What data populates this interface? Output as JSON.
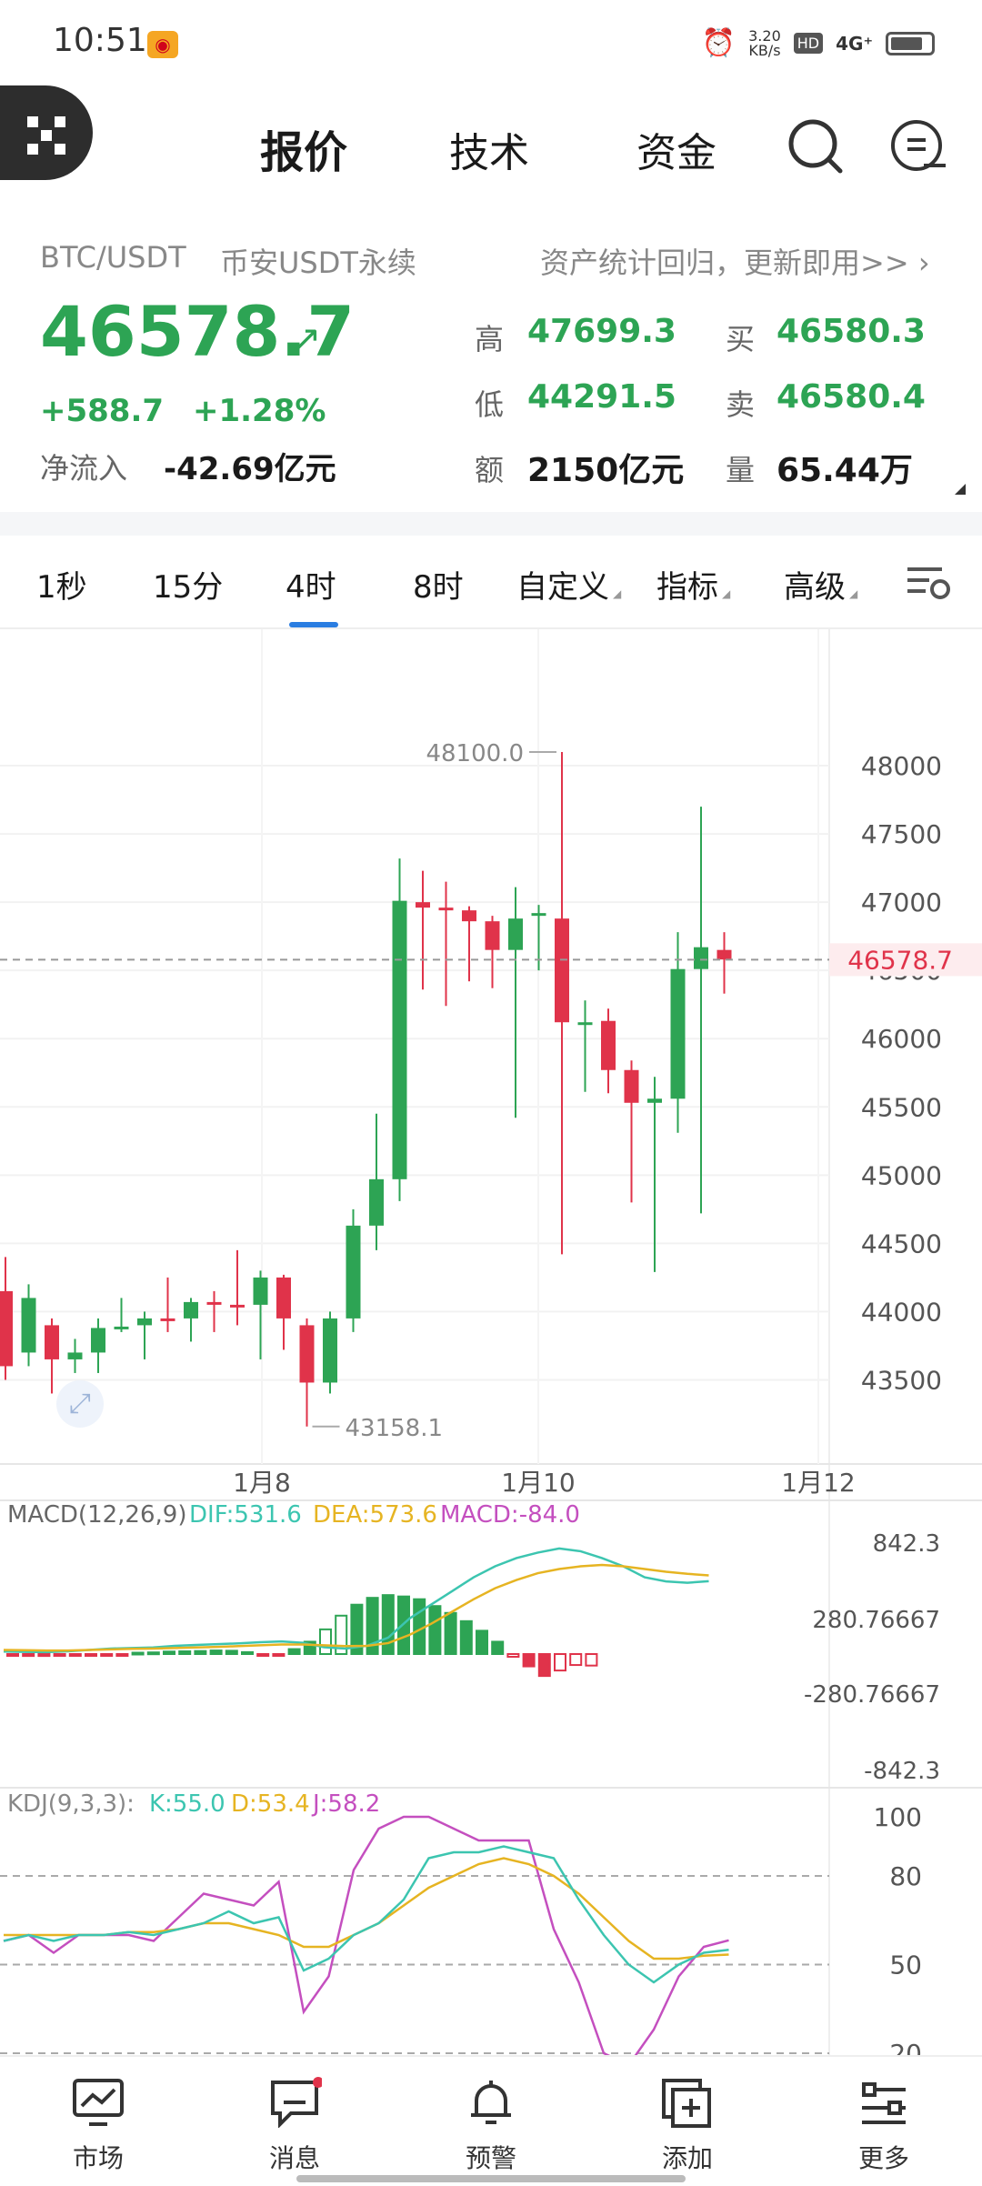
{
  "status_bar": {
    "time": "10:51",
    "net_speed": "3.20\nKB/s",
    "hd": "HD",
    "signal": "4G⁺"
  },
  "header": {
    "tabs": [
      {
        "label": "报价"
      },
      {
        "label": "技术"
      },
      {
        "label": "资金"
      }
    ],
    "active_tab": "报价"
  },
  "ticker": {
    "pair": "BTC/USDT",
    "market": "币安USDT永续",
    "promo": "资产统计回归，更新即用>>",
    "price": "46578.7",
    "change_abs": "+588.7",
    "change_pct": "+1.28%",
    "net_inflow_label": "净流入",
    "net_inflow_value": "-42.69亿元",
    "stats": {
      "high_label": "高",
      "high_value": "47699.3",
      "low_label": "低",
      "low_value": "44291.5",
      "amount_label": "额",
      "amount_value": "2150亿元",
      "buy_label": "买",
      "buy_value": "46580.3",
      "sell_label": "卖",
      "sell_value": "46580.4",
      "volume_label": "量",
      "volume_value": "65.44万"
    },
    "colors": {
      "up": "#2da454",
      "down": "#e0334a"
    }
  },
  "intervals": {
    "items": [
      {
        "label": "1秒"
      },
      {
        "label": "15分"
      },
      {
        "label": "4时"
      },
      {
        "label": "8时"
      },
      {
        "label": "自定义"
      },
      {
        "label": "指标"
      },
      {
        "label": "高级"
      }
    ],
    "active": "4时"
  },
  "chart_data": {
    "type": "candlestick",
    "x_ticks": [
      "1月8",
      "1月10",
      "1月12"
    ],
    "y_ticks": [
      48000,
      47500,
      47000,
      46500,
      46000,
      45500,
      45000,
      44500,
      44000,
      43500
    ],
    "ylim": [
      42950,
      48600
    ],
    "current_price_label": "46578.7",
    "high_marker": "48100.0",
    "low_marker": "43158.1",
    "candles": [
      {
        "o": 44150,
        "c": 43600,
        "h": 44400,
        "l": 43500
      },
      {
        "o": 43700,
        "c": 44100,
        "h": 44200,
        "l": 43600
      },
      {
        "o": 43900,
        "c": 43650,
        "h": 43950,
        "l": 43400
      },
      {
        "o": 43650,
        "c": 43700,
        "h": 43800,
        "l": 43550
      },
      {
        "o": 43700,
        "c": 43880,
        "h": 43950,
        "l": 43550
      },
      {
        "o": 43880,
        "c": 43890,
        "h": 44100,
        "l": 43850
      },
      {
        "o": 43900,
        "c": 43950,
        "h": 44000,
        "l": 43650
      },
      {
        "o": 43950,
        "c": 43940,
        "h": 44250,
        "l": 43850
      },
      {
        "o": 43950,
        "c": 44070,
        "h": 44100,
        "l": 43780
      },
      {
        "o": 44070,
        "c": 44050,
        "h": 44150,
        "l": 43850
      },
      {
        "o": 44050,
        "c": 44040,
        "h": 44450,
        "l": 43900
      },
      {
        "o": 44050,
        "c": 44250,
        "h": 44300,
        "l": 43650
      },
      {
        "o": 44250,
        "c": 43950,
        "h": 44270,
        "l": 43720
      },
      {
        "o": 43900,
        "c": 43480,
        "h": 43950,
        "l": 43158.1
      },
      {
        "o": 43480,
        "c": 43950,
        "h": 44000,
        "l": 43400
      },
      {
        "o": 43950,
        "c": 44630,
        "h": 44750,
        "l": 43850
      },
      {
        "o": 44630,
        "c": 44970,
        "h": 45450,
        "l": 44450
      },
      {
        "o": 44970,
        "c": 47010,
        "h": 47320,
        "l": 44810
      },
      {
        "o": 47000,
        "c": 46960,
        "h": 47230,
        "l": 46360
      },
      {
        "o": 46960,
        "c": 46940,
        "h": 47150,
        "l": 46240
      },
      {
        "o": 46940,
        "c": 46860,
        "h": 46970,
        "l": 46420
      },
      {
        "o": 46860,
        "c": 46650,
        "h": 46900,
        "l": 46370
      },
      {
        "o": 46650,
        "c": 46880,
        "h": 47110,
        "l": 45420
      },
      {
        "o": 46900,
        "c": 46920,
        "h": 46980,
        "l": 46500
      },
      {
        "o": 46880,
        "c": 46120,
        "h": 48100,
        "l": 44420
      },
      {
        "o": 46120,
        "c": 46120,
        "h": 46280,
        "l": 45610
      },
      {
        "o": 46130,
        "c": 45770,
        "h": 46220,
        "l": 45600
      },
      {
        "o": 45770,
        "c": 45530,
        "h": 45840,
        "l": 44800
      },
      {
        "o": 45530,
        "c": 45560,
        "h": 45720,
        "l": 44290
      },
      {
        "o": 45560,
        "c": 46510,
        "h": 46780,
        "l": 45310
      },
      {
        "o": 46510,
        "c": 46670,
        "h": 47700,
        "l": 44720
      },
      {
        "o": 46650,
        "c": 46580,
        "h": 46780,
        "l": 46330
      }
    ],
    "macd": {
      "label": "MACD(12,26,9)",
      "dif_text": "DIF:531.6",
      "dea_text": "DEA:573.6",
      "macd_text": "MACD:-84.0",
      "y_ticks": [
        "842.3",
        "280.76667",
        "-280.76667",
        "-842.3"
      ],
      "ylim": [
        -842.3,
        842.3
      ],
      "histogram": [
        -12,
        -14,
        -14,
        -12,
        -9,
        -6,
        -4,
        -3,
        10,
        12,
        18,
        20,
        22,
        26,
        24,
        14,
        -8,
        -4,
        36,
        90,
        180,
        280,
        360,
        410,
        430,
        420,
        400,
        350,
        300,
        240,
        170,
        90,
        -20,
        -90,
        -160,
        -120,
        -80,
        -84
      ],
      "dif": [
        18,
        16,
        14,
        20,
        30,
        40,
        44,
        48,
        60,
        66,
        72,
        78,
        86,
        92,
        82,
        50,
        40,
        60,
        120,
        260,
        360,
        460,
        560,
        640,
        700,
        740,
        770,
        750,
        700,
        640,
        560,
        530,
        520,
        531.6
      ],
      "dea": [
        30,
        28,
        26,
        26,
        30,
        34,
        38,
        40,
        44,
        48,
        52,
        58,
        64,
        70,
        70,
        64,
        58,
        60,
        80,
        140,
        220,
        310,
        400,
        480,
        540,
        590,
        620,
        640,
        650,
        640,
        620,
        600,
        585,
        573.6
      ]
    },
    "kdj": {
      "label": "KDJ(9,3,3):",
      "k_text": "K:55.0",
      "d_text": "D:53.4",
      "j_text": "J:58.2",
      "y_ticks": [
        "100",
        "80",
        "50",
        "20"
      ],
      "ylim": [
        20,
        100
      ],
      "k": [
        58,
        60,
        58,
        60,
        60,
        61,
        60,
        62,
        64,
        68,
        64,
        66,
        48,
        52,
        60,
        64,
        72,
        86,
        88,
        88,
        90,
        88,
        86,
        72,
        60,
        50,
        44,
        50,
        54,
        55
      ],
      "d": [
        60,
        60,
        60,
        60,
        60,
        61,
        61,
        62,
        64,
        64,
        62,
        60,
        56,
        56,
        60,
        64,
        70,
        76,
        80,
        84,
        86,
        84,
        80,
        74,
        66,
        58,
        52,
        52,
        53,
        53.4
      ],
      "j": [
        58,
        60,
        54,
        60,
        60,
        60,
        58,
        66,
        74,
        72,
        70,
        78,
        34,
        46,
        82,
        96,
        100,
        100,
        96,
        92,
        92,
        92,
        62,
        44,
        20,
        16,
        28,
        46,
        56,
        58.2
      ]
    }
  },
  "bottom_nav": [
    {
      "label": "市场",
      "icon": "market-chart-icon"
    },
    {
      "label": "消息",
      "icon": "message-icon"
    },
    {
      "label": "预警",
      "icon": "bell-icon"
    },
    {
      "label": "添加",
      "icon": "add-icon"
    },
    {
      "label": "更多",
      "icon": "more-settings-icon"
    }
  ]
}
